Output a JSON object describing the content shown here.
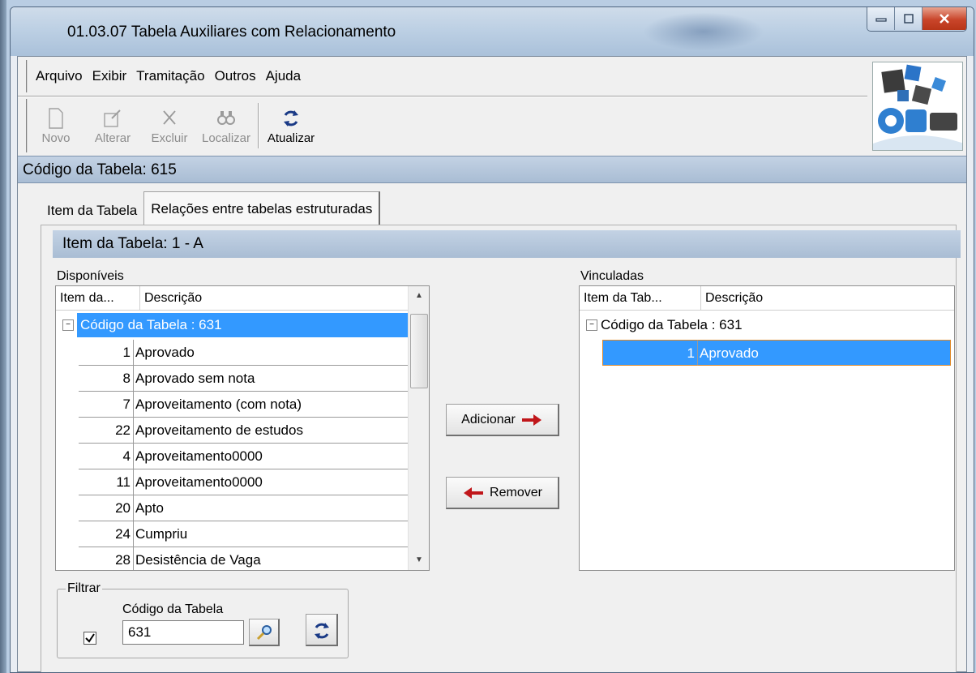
{
  "window": {
    "title": "01.03.07 Tabela Auxiliares com Relacionamento"
  },
  "menu": [
    "Arquivo",
    "Exibir",
    "Tramitação",
    "Outros",
    "Ajuda"
  ],
  "toolbar": {
    "novo": "Novo",
    "alterar": "Alterar",
    "excluir": "Excluir",
    "localizar": "Localizar",
    "atualizar": "Atualizar"
  },
  "code_bar": "Código da Tabela: 615",
  "tabs": [
    "Item da Tabela",
    "Relações entre tabelas estruturadas"
  ],
  "item_bar": "Item da Tabela: 1 - A",
  "disponiveis": {
    "label": "Disponíveis",
    "col_item": "Item da...",
    "col_desc": "Descrição",
    "group": "Código da Tabela : 631",
    "rows": [
      {
        "num": "1",
        "desc": "Aprovado"
      },
      {
        "num": "8",
        "desc": "Aprovado sem nota"
      },
      {
        "num": "7",
        "desc": "Aproveitamento (com nota)"
      },
      {
        "num": "22",
        "desc": "Aproveitamento de estudos"
      },
      {
        "num": "4",
        "desc": "Aproveitamento0000"
      },
      {
        "num": "11",
        "desc": "Aproveitamento0000"
      },
      {
        "num": "20",
        "desc": "Apto"
      },
      {
        "num": "24",
        "desc": "Cumpriu"
      },
      {
        "num": "28",
        "desc": "Desistência de Vaga"
      }
    ]
  },
  "vinculadas": {
    "label": "Vinculadas",
    "col_item": "Item da Tab...",
    "col_desc": "Descrição",
    "group": "Código da Tabela : 631",
    "rows": [
      {
        "num": "1",
        "desc": "Aprovado"
      }
    ]
  },
  "buttons": {
    "adicionar": "Adicionar",
    "remover": "Remover"
  },
  "filter": {
    "legend": "Filtrar",
    "field_label": "Código da Tabela",
    "value": "631",
    "checked": true
  }
}
